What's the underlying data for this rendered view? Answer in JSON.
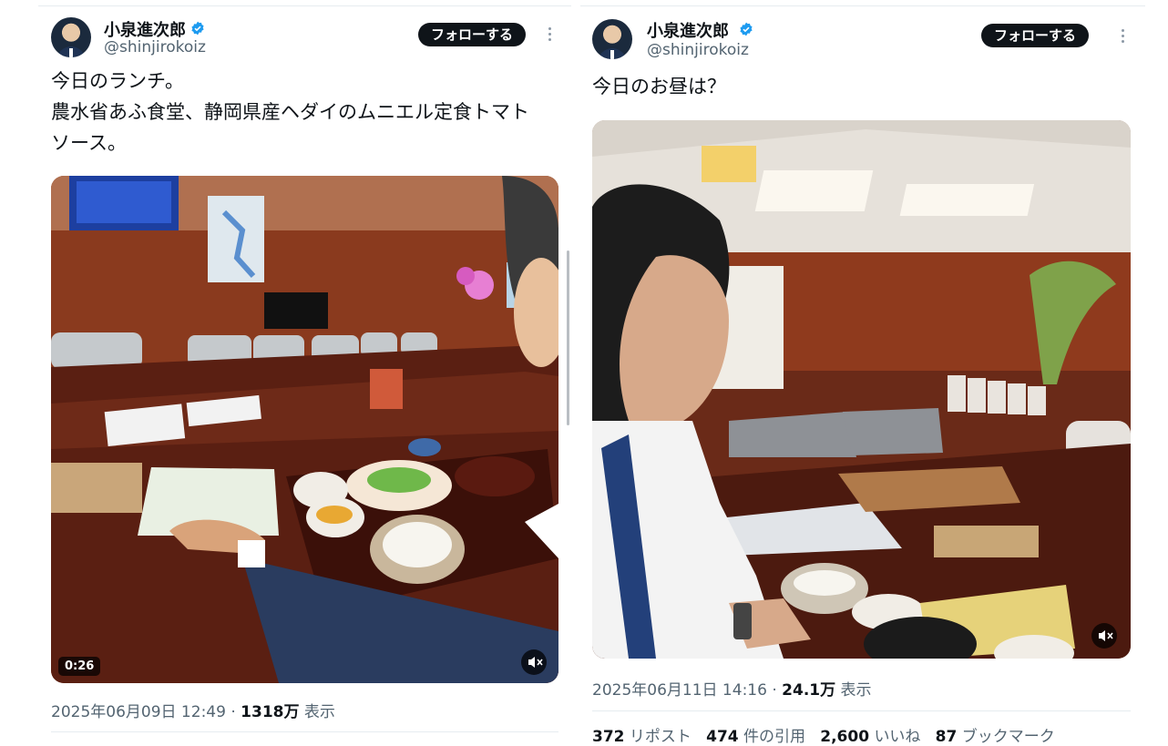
{
  "left_tweet": {
    "author_name": "小泉進次郎",
    "handle": "@shinjirokoiz",
    "follow_label": "フォローする",
    "text_lines": [
      "今日のランチ。",
      "農水省あふ食堂、静岡県産ヘダイのムニエル定食トマト",
      "ソース。"
    ],
    "video_time": "0:26",
    "date": "2025年06月09日 12:49",
    "sep": "·",
    "views": "1318万",
    "views_label": "表示"
  },
  "right_tweet": {
    "author_name": "小泉進次郎",
    "handle": "@shinjirokoiz",
    "follow_label": "フォローする",
    "text": "今日のお昼は？",
    "date": "2025年06月11日 14:16",
    "sep": "·",
    "views": "24.1万",
    "views_label": "表示",
    "stats": {
      "reposts": "372",
      "reposts_label": "リポスト",
      "quotes": "474",
      "quotes_label": "件の引用",
      "likes": "2,600",
      "likes_label": "いいね",
      "bookmarks": "87",
      "bookmarks_label": "ブックマーク"
    }
  },
  "colors": {
    "verified": "#1d9bf0",
    "wall_wood": "#8a3a1e",
    "table_wood": "#5a1f12",
    "ceiling": "#e9e4dd"
  },
  "icons": [
    "verified-badge-icon",
    "more-options-icon",
    "mute-icon"
  ]
}
